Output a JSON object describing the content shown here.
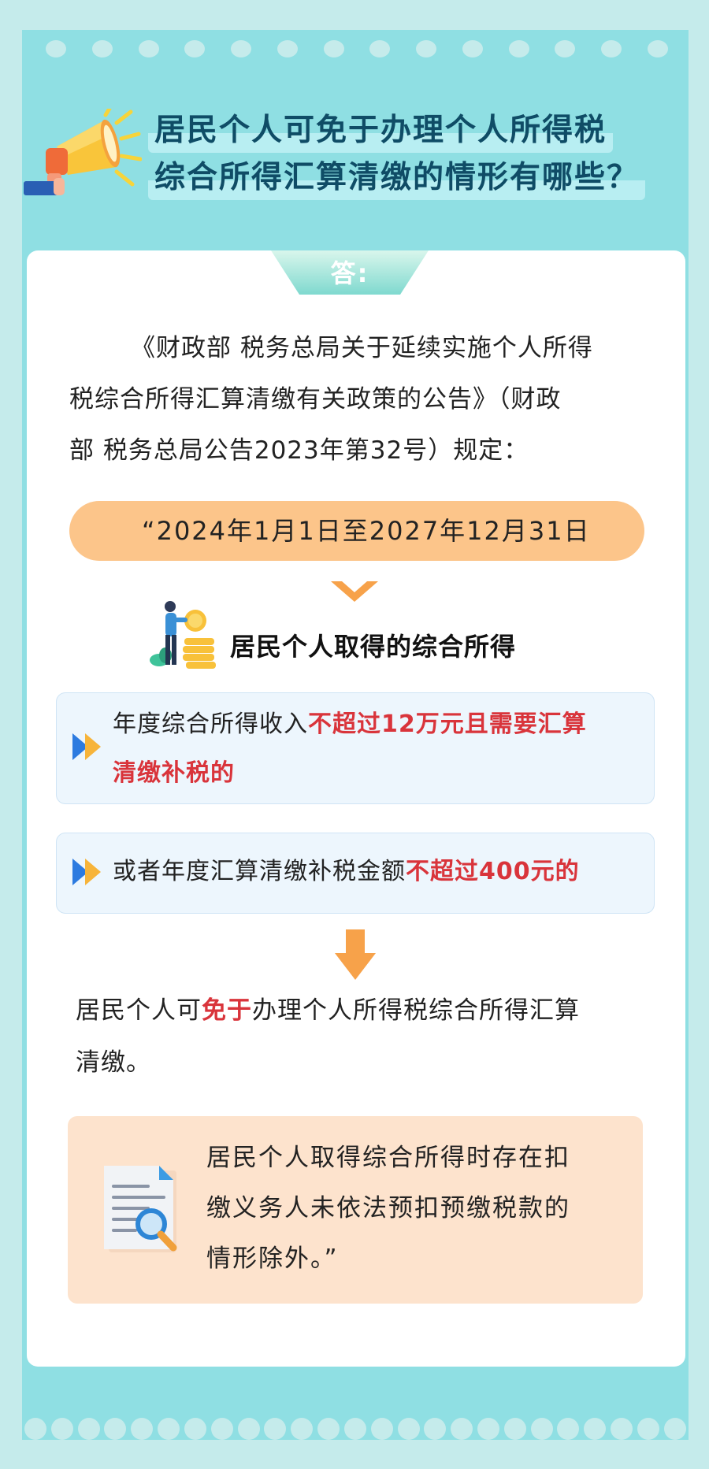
{
  "header": {
    "title_line1": "居民个人可免于办理个人所得税",
    "title_line2": "综合所得汇算清缴的情形有哪些？"
  },
  "answer": {
    "label": "答:"
  },
  "intro": {
    "line1": "《财政部 税务总局关于延续实施个人所得",
    "line2": "税综合所得汇算清缴有关政策的公告》（财政",
    "line3": "部 税务总局公告2023年第32号）规定："
  },
  "date_range": "“2024年1月1日至2027年12月31日",
  "section": {
    "heading": "居民个人取得的综合所得"
  },
  "conditions": [
    {
      "normal": "年度综合所得收入",
      "highlight_1": "不超过12万元且需要汇算",
      "highlight_2": "清缴补税的"
    },
    {
      "normal": "或者年度汇算清缴补税金额",
      "highlight": "不超过400元的"
    }
  ],
  "conclusion": {
    "part1": "居民个人可",
    "highlight": "免于",
    "part2": "办理个人所得税综合所得汇算",
    "line2": "清缴。"
  },
  "exception": {
    "line1": "居民个人取得综合所得时存在扣",
    "line2": "缴义务人未依法预扣预缴税款的",
    "line3": "情形除外。”"
  },
  "colors": {
    "frame": "#8fdfe3",
    "background": "#c5ebeb",
    "title_text": "#0f4c66",
    "pill": "#fcc58a",
    "highlight_red": "#d9343b",
    "arrow_orange": "#f7a24a",
    "info_box": "#edf6fd",
    "exception_box": "#fde3cd"
  },
  "icons": {
    "header": "megaphone-icon",
    "section": "person-with-coins-icon",
    "bullet": "double-chevron-right-icon",
    "flow": "down-arrow-icon",
    "exception": "document-search-icon"
  }
}
